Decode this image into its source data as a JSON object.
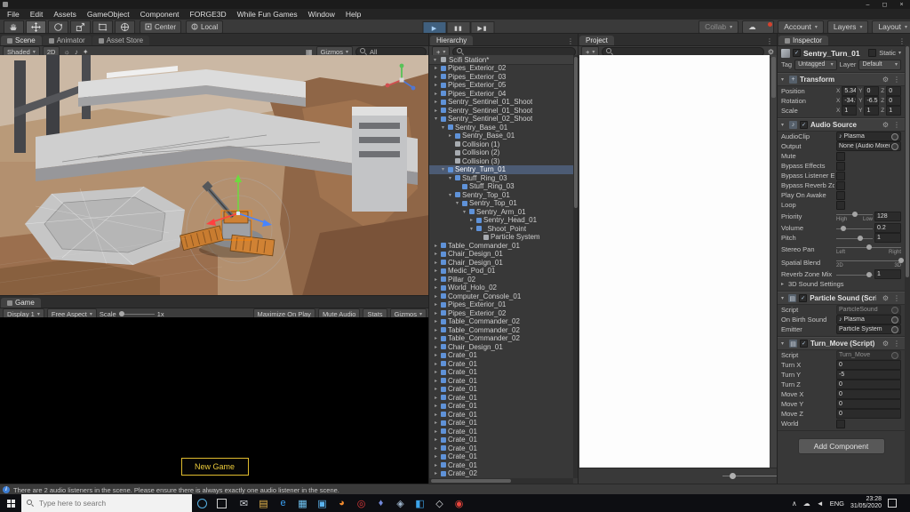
{
  "icons": {
    "play": "▶",
    "pause": "▮▮",
    "step": "▶▮",
    "dropdown": "▾",
    "foldout_open": "▾",
    "foldout_closed": "▸",
    "gear": "⚙",
    "dots": "⋮",
    "note": "♪",
    "cloud": "☁",
    "check": "✓",
    "plus": "+",
    "info": "i",
    "lighting": "☼",
    "audio_toggle": "♪",
    "effects": "✦",
    "grid": "▦",
    "minimize": "–",
    "maximize": "◻",
    "close": "×",
    "tray_caret": "∧",
    "tray_cloud": "☁",
    "tray_volume": "◄"
  },
  "menubar": {
    "items": [
      "File",
      "Edit",
      "Assets",
      "GameObject",
      "Component",
      "FORGE3D",
      "While Fun Games",
      "Window",
      "Help"
    ]
  },
  "toolbar": {
    "pivot_label": "Center",
    "space_label": "Local",
    "collab_label": "Collab",
    "account_label": "Account",
    "layers_label": "Layers",
    "layout_label": "Layout"
  },
  "scene_panel": {
    "tabs": [
      "Scene",
      "Animator",
      "Asset Store"
    ],
    "shading_mode": "Shaded",
    "mode_2d": "2D",
    "gizmos_label": "Gizmos",
    "search_value": "All"
  },
  "game_panel": {
    "tab": "Game",
    "display": "Display 1",
    "aspect": "Free Aspect",
    "scale_label": "Scale",
    "scale_value": "1x",
    "maximize_label": "Maximize On Play",
    "mute_label": "Mute Audio",
    "stats_label": "Stats",
    "gizmos_label": "Gizmos",
    "new_game_label": "New Game"
  },
  "hierarchy": {
    "tab": "Hierarchy",
    "scene_name": "Scifi Station*",
    "items": [
      {
        "label": "Pipes_Exterior_02",
        "indent": 1,
        "arrow": "r"
      },
      {
        "label": "Pipes_Exterior_03",
        "indent": 1,
        "arrow": "r"
      },
      {
        "label": "Pipes_Exterior_05",
        "indent": 1,
        "arrow": "r"
      },
      {
        "label": "Pipes_Exterior_04",
        "indent": 1,
        "arrow": "r"
      },
      {
        "label": "Sentry_Sentinel_01_Shoot",
        "indent": 1,
        "arrow": "r"
      },
      {
        "label": "Sentry_Sentinel_01_Shoot",
        "indent": 1,
        "arrow": "r"
      },
      {
        "label": "Sentry_Sentinel_02_Shoot",
        "indent": 1,
        "arrow": "d"
      },
      {
        "label": "Sentry_Base_01",
        "indent": 2,
        "arrow": "d"
      },
      {
        "label": "Sentry_Base_01",
        "indent": 3,
        "arrow": "r"
      },
      {
        "label": "Collision (1)",
        "indent": 3,
        "arrow": ""
      },
      {
        "label": "Collision (2)",
        "indent": 3,
        "arrow": ""
      },
      {
        "label": "Collision (3)",
        "indent": 3,
        "arrow": ""
      },
      {
        "label": "Sentry_Turn_01",
        "indent": 2,
        "arrow": "d",
        "selected": true
      },
      {
        "label": "Stuff_Ring_03",
        "indent": 3,
        "arrow": "d"
      },
      {
        "label": "Stuff_Ring_03",
        "indent": 4,
        "arrow": ""
      },
      {
        "label": "Sentry_Top_01",
        "indent": 3,
        "arrow": "d"
      },
      {
        "label": "Sentry_Top_01",
        "indent": 4,
        "arrow": "d"
      },
      {
        "label": "Sentry_Arm_01",
        "indent": 5,
        "arrow": "d"
      },
      {
        "label": "Sentry_Head_01",
        "indent": 6,
        "arrow": "r"
      },
      {
        "label": "_Shoot_Point",
        "indent": 6,
        "arrow": "d"
      },
      {
        "label": "Particle System",
        "indent": 7,
        "arrow": ""
      },
      {
        "label": "Table_Commander_01",
        "indent": 1,
        "arrow": "r"
      },
      {
        "label": "Chair_Design_01",
        "indent": 1,
        "arrow": "r"
      },
      {
        "label": "Chair_Design_01",
        "indent": 1,
        "arrow": "r"
      },
      {
        "label": "Medic_Pod_01",
        "indent": 1,
        "arrow": "r"
      },
      {
        "label": "Pillar_02",
        "indent": 1,
        "arrow": "r"
      },
      {
        "label": "World_Holo_02",
        "indent": 1,
        "arrow": "r"
      },
      {
        "label": "Computer_Console_01",
        "indent": 1,
        "arrow": "r"
      },
      {
        "label": "Pipes_Exterior_01",
        "indent": 1,
        "arrow": "r"
      },
      {
        "label": "Pipes_Exterior_02",
        "indent": 1,
        "arrow": "r"
      },
      {
        "label": "Table_Commander_02",
        "indent": 1,
        "arrow": "r"
      },
      {
        "label": "Table_Commander_02",
        "indent": 1,
        "arrow": "r"
      },
      {
        "label": "Table_Commander_02",
        "indent": 1,
        "arrow": "r"
      },
      {
        "label": "Chair_Design_01",
        "indent": 1,
        "arrow": "r"
      },
      {
        "label": "Crate_01",
        "indent": 1,
        "arrow": "r"
      },
      {
        "label": "Crate_01",
        "indent": 1,
        "arrow": "r"
      },
      {
        "label": "Crate_01",
        "indent": 1,
        "arrow": "r"
      },
      {
        "label": "Crate_01",
        "indent": 1,
        "arrow": "r"
      },
      {
        "label": "Crate_01",
        "indent": 1,
        "arrow": "r"
      },
      {
        "label": "Crate_01",
        "indent": 1,
        "arrow": "r"
      },
      {
        "label": "Crate_01",
        "indent": 1,
        "arrow": "r"
      },
      {
        "label": "Crate_01",
        "indent": 1,
        "arrow": "r"
      },
      {
        "label": "Crate_01",
        "indent": 1,
        "arrow": "r"
      },
      {
        "label": "Crate_01",
        "indent": 1,
        "arrow": "r"
      },
      {
        "label": "Crate_01",
        "indent": 1,
        "arrow": "r"
      },
      {
        "label": "Crate_01",
        "indent": 1,
        "arrow": "r"
      },
      {
        "label": "Crate_01",
        "indent": 1,
        "arrow": "r"
      },
      {
        "label": "Crate_01",
        "indent": 1,
        "arrow": "r"
      },
      {
        "label": "Crate_02",
        "indent": 1,
        "arrow": "r"
      }
    ]
  },
  "project": {
    "tab": "Project"
  },
  "inspector": {
    "tab": "Inspector",
    "header": {
      "name": "Sentry_Turn_01",
      "static_label": "Static",
      "tag_label": "Tag",
      "tag_value": "Untagged",
      "layer_label": "Layer",
      "layer_value": "Default"
    },
    "transform": {
      "title": "Transform",
      "axes": [
        "X",
        "Y",
        "Z"
      ],
      "rows": [
        {
          "label": "Position",
          "x": "5.3405",
          "y": "0",
          "z": "0"
        },
        {
          "label": "Rotation",
          "x": "-34.95",
          "y": "-6.516",
          "z": "0"
        },
        {
          "label": "Scale",
          "x": "1",
          "y": "1",
          "z": "1"
        }
      ]
    },
    "audio_source": {
      "title": "Audio Source",
      "rows": [
        {
          "label": "AudioClip",
          "type": "object",
          "value": "Plasma",
          "icon": true
        },
        {
          "label": "Output",
          "type": "object",
          "value": "None (Audio Mixer)"
        },
        {
          "label": "Mute",
          "type": "check",
          "checked": false
        },
        {
          "label": "Bypass Effects",
          "type": "check",
          "checked": false
        },
        {
          "label": "Bypass Listener Effec",
          "type": "check",
          "checked": false
        },
        {
          "label": "Bypass Reverb Zones",
          "type": "check",
          "checked": false
        },
        {
          "label": "Play On Awake",
          "type": "check",
          "checked": false
        },
        {
          "label": "Loop",
          "type": "check",
          "checked": false
        },
        {
          "label": "Priority",
          "type": "slider",
          "pos": 50,
          "value": "128",
          "sub_left": "High",
          "sub_right": "Low"
        },
        {
          "label": "Volume",
          "type": "slider",
          "pos": 20,
          "value": "0.2"
        },
        {
          "label": "Pitch",
          "type": "slider",
          "pos": 67,
          "value": "1"
        },
        {
          "label": "Stereo Pan",
          "type": "slider",
          "pos": 50,
          "sub_left": "Left",
          "sub_right": "Right"
        },
        {
          "label": "Spatial Blend",
          "type": "slider",
          "pos": 100,
          "sub_left": "2D",
          "sub_right": "3D"
        },
        {
          "label": "Reverb Zone Mix",
          "type": "slider",
          "pos": 91,
          "value": "1"
        },
        {
          "label": "3D Sound Settings",
          "type": "foldout"
        }
      ]
    },
    "particle_sound": {
      "title": "Particle Sound (Script)",
      "rows": [
        {
          "label": "Script",
          "type": "object",
          "value": "ParticleSound",
          "disabled": true
        },
        {
          "label": "On Birth Sound",
          "type": "object",
          "value": "Plasma",
          "icon": true
        },
        {
          "label": "Emitter",
          "type": "object",
          "value": "Particle System"
        }
      ]
    },
    "turn_move": {
      "title": "Turn_Move (Script)",
      "rows": [
        {
          "label": "Script",
          "type": "object",
          "value": "Turn_Move",
          "disabled": true
        },
        {
          "label": "Turn X",
          "type": "text",
          "value": "0"
        },
        {
          "label": "Turn Y",
          "type": "text",
          "value": "-5"
        },
        {
          "label": "Turn Z",
          "type": "text",
          "value": "0"
        },
        {
          "label": "Move X",
          "type": "text",
          "value": "0"
        },
        {
          "label": "Move Y",
          "type": "text",
          "value": "0"
        },
        {
          "label": "Move Z",
          "type": "text",
          "value": "0"
        },
        {
          "label": "World",
          "type": "check",
          "checked": false
        }
      ]
    },
    "add_component_label": "Add Component"
  },
  "status_bar": {
    "message": "There are 2 audio listeners in the scene. Please ensure there is always exactly one audio listener in the scene."
  },
  "taskbar": {
    "search_placeholder": "Type here to search",
    "language": "ENG",
    "time": "23:28",
    "date": "31/05/2020",
    "apps": [
      {
        "name": "mail",
        "glyph": "✉",
        "color": "#cfd3d8"
      },
      {
        "name": "explorer",
        "glyph": "▤",
        "color": "#e8b64c"
      },
      {
        "name": "edge",
        "glyph": "e",
        "color": "#3aa0f3"
      },
      {
        "name": "store",
        "glyph": "▦",
        "color": "#6fc3f2"
      },
      {
        "name": "photos",
        "glyph": "▣",
        "color": "#5bb4f0"
      },
      {
        "name": "firefox",
        "glyph": "◕",
        "color": "#f28b2d"
      },
      {
        "name": "opera",
        "glyph": "◎",
        "color": "#e23a3a"
      },
      {
        "name": "discord",
        "glyph": "♦",
        "color": "#7289da"
      },
      {
        "name": "steam",
        "glyph": "◈",
        "color": "#9fb6cd"
      },
      {
        "name": "vscode",
        "glyph": "◧",
        "color": "#3ba3e8"
      },
      {
        "name": "unity",
        "glyph": "◇",
        "color": "#d5d8dc"
      },
      {
        "name": "chrome",
        "glyph": "◉",
        "color": "#e8453c"
      }
    ]
  }
}
